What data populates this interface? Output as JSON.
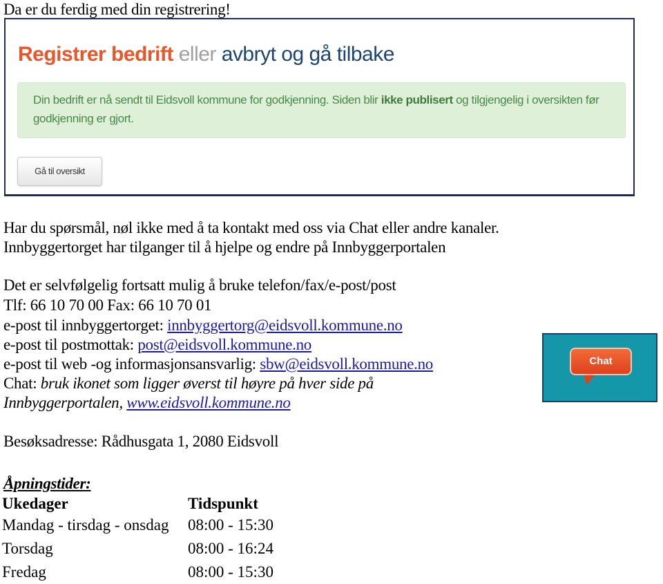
{
  "intro": "Da er du ferdig med din registrering!",
  "screenshot": {
    "title_part1": "Registrer bedrift",
    "title_part2": " eller ",
    "title_part3": "avbryt og gå tilbake",
    "alert_text1": "Din bedrift er nå sendt til Eidsvoll kommune for godkjenning. Siden blir ",
    "alert_bold": "ikke publisert",
    "alert_text2": " og tilgjengelig i oversikten før godkjenning er gjort.",
    "button_label": "Gå til oversikt",
    "colors": {
      "accent": "#e8572a",
      "navy": "#1c4470",
      "alert_bg": "#dff0d8",
      "alert_text": "#468847"
    }
  },
  "contact": {
    "line1": "Har du spørsmål, nøl ikke med å ta kontakt med oss via Chat eller andre kanaler.",
    "line2": "Innbyggertorget har tilganger til å hjelpe og endre på Innbyggerportalen",
    "line3": "Det er selvfølgelig fortsatt mulig å bruke telefon/fax/e-post/post",
    "line4": "Tlf: 66 10 70 00 Fax: 66 10 70 01",
    "email1_label": "e-post til innbyggertorget: ",
    "email1": "innbyggertorg@eidsvoll.kommune.no",
    "email2_label": "e-post til postmottak: ",
    "email2": "post@eidsvoll.kommune.no",
    "email3_label": "e-post til web -og informasjonsansvarlig: ",
    "email3": "sbw@eidsvoll.kommune.no",
    "chat_label": "Chat: ",
    "chat_text": "bruk ikonet som ligger øverst til høyre på hver side på",
    "chat_text2": "Innbyggerportalen, ",
    "website": "www.eidsvoll.kommune.no"
  },
  "chat_image": {
    "label": "Chat",
    "icon": "chat-bubble-icon",
    "bg": "#1497a9"
  },
  "address": "Besøksadresse: Rådhusgata 1, 2080 Eidsvoll",
  "hours": {
    "heading": "Åpningstider:",
    "col_days": "Ukedager",
    "col_time": "Tidspunkt",
    "rows": [
      {
        "day": "Mandag - tirsdag - onsdag",
        "time": "08:00 - 15:30"
      },
      {
        "day": "Torsdag",
        "time": "08:00 - 16:24"
      },
      {
        "day": "Fredag",
        "time": "08:00 - 15:30"
      }
    ]
  }
}
